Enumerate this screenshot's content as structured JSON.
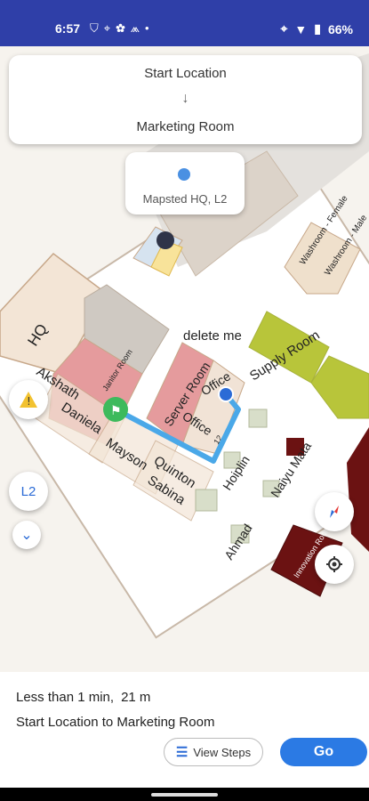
{
  "status": {
    "time": "6:57",
    "left_icons": [
      "shield-icon",
      "location-icon",
      "settings-circle-icon",
      "app-icon",
      "dot-icon"
    ],
    "battery": "66%"
  },
  "route": {
    "from": "Start Location",
    "arrow": "↓",
    "to": "Marketing Room"
  },
  "location": {
    "label": "Mapsted HQ, L2"
  },
  "map_labels": {
    "hq": "HQ",
    "janitor": "Janitor Room",
    "server": "Server Room",
    "office1": "Office",
    "office2": "Office",
    "delete": "delete me",
    "supply": "Supply Room",
    "washroom_f": "Washroom - Female",
    "washroom_m": "Washroom - Male",
    "akshath": "Akshath",
    "daniela": "Daniela",
    "mayson": "Mayson",
    "quinton": "Quinton",
    "sabina": "Sabina",
    "ahmad": "Ahmad",
    "hoiplin": "Hoiplin",
    "naiyu": "Naiyu Mata",
    "innovation": "Innovation Room",
    "small12": "12"
  },
  "controls": {
    "floor": "L2",
    "chevron": "⌄"
  },
  "summary": {
    "eta": "Less than 1 min,",
    "distance": "21 m",
    "description": "Start Location to Marketing Room",
    "steps_label": "View Steps",
    "go_label": "Go"
  }
}
